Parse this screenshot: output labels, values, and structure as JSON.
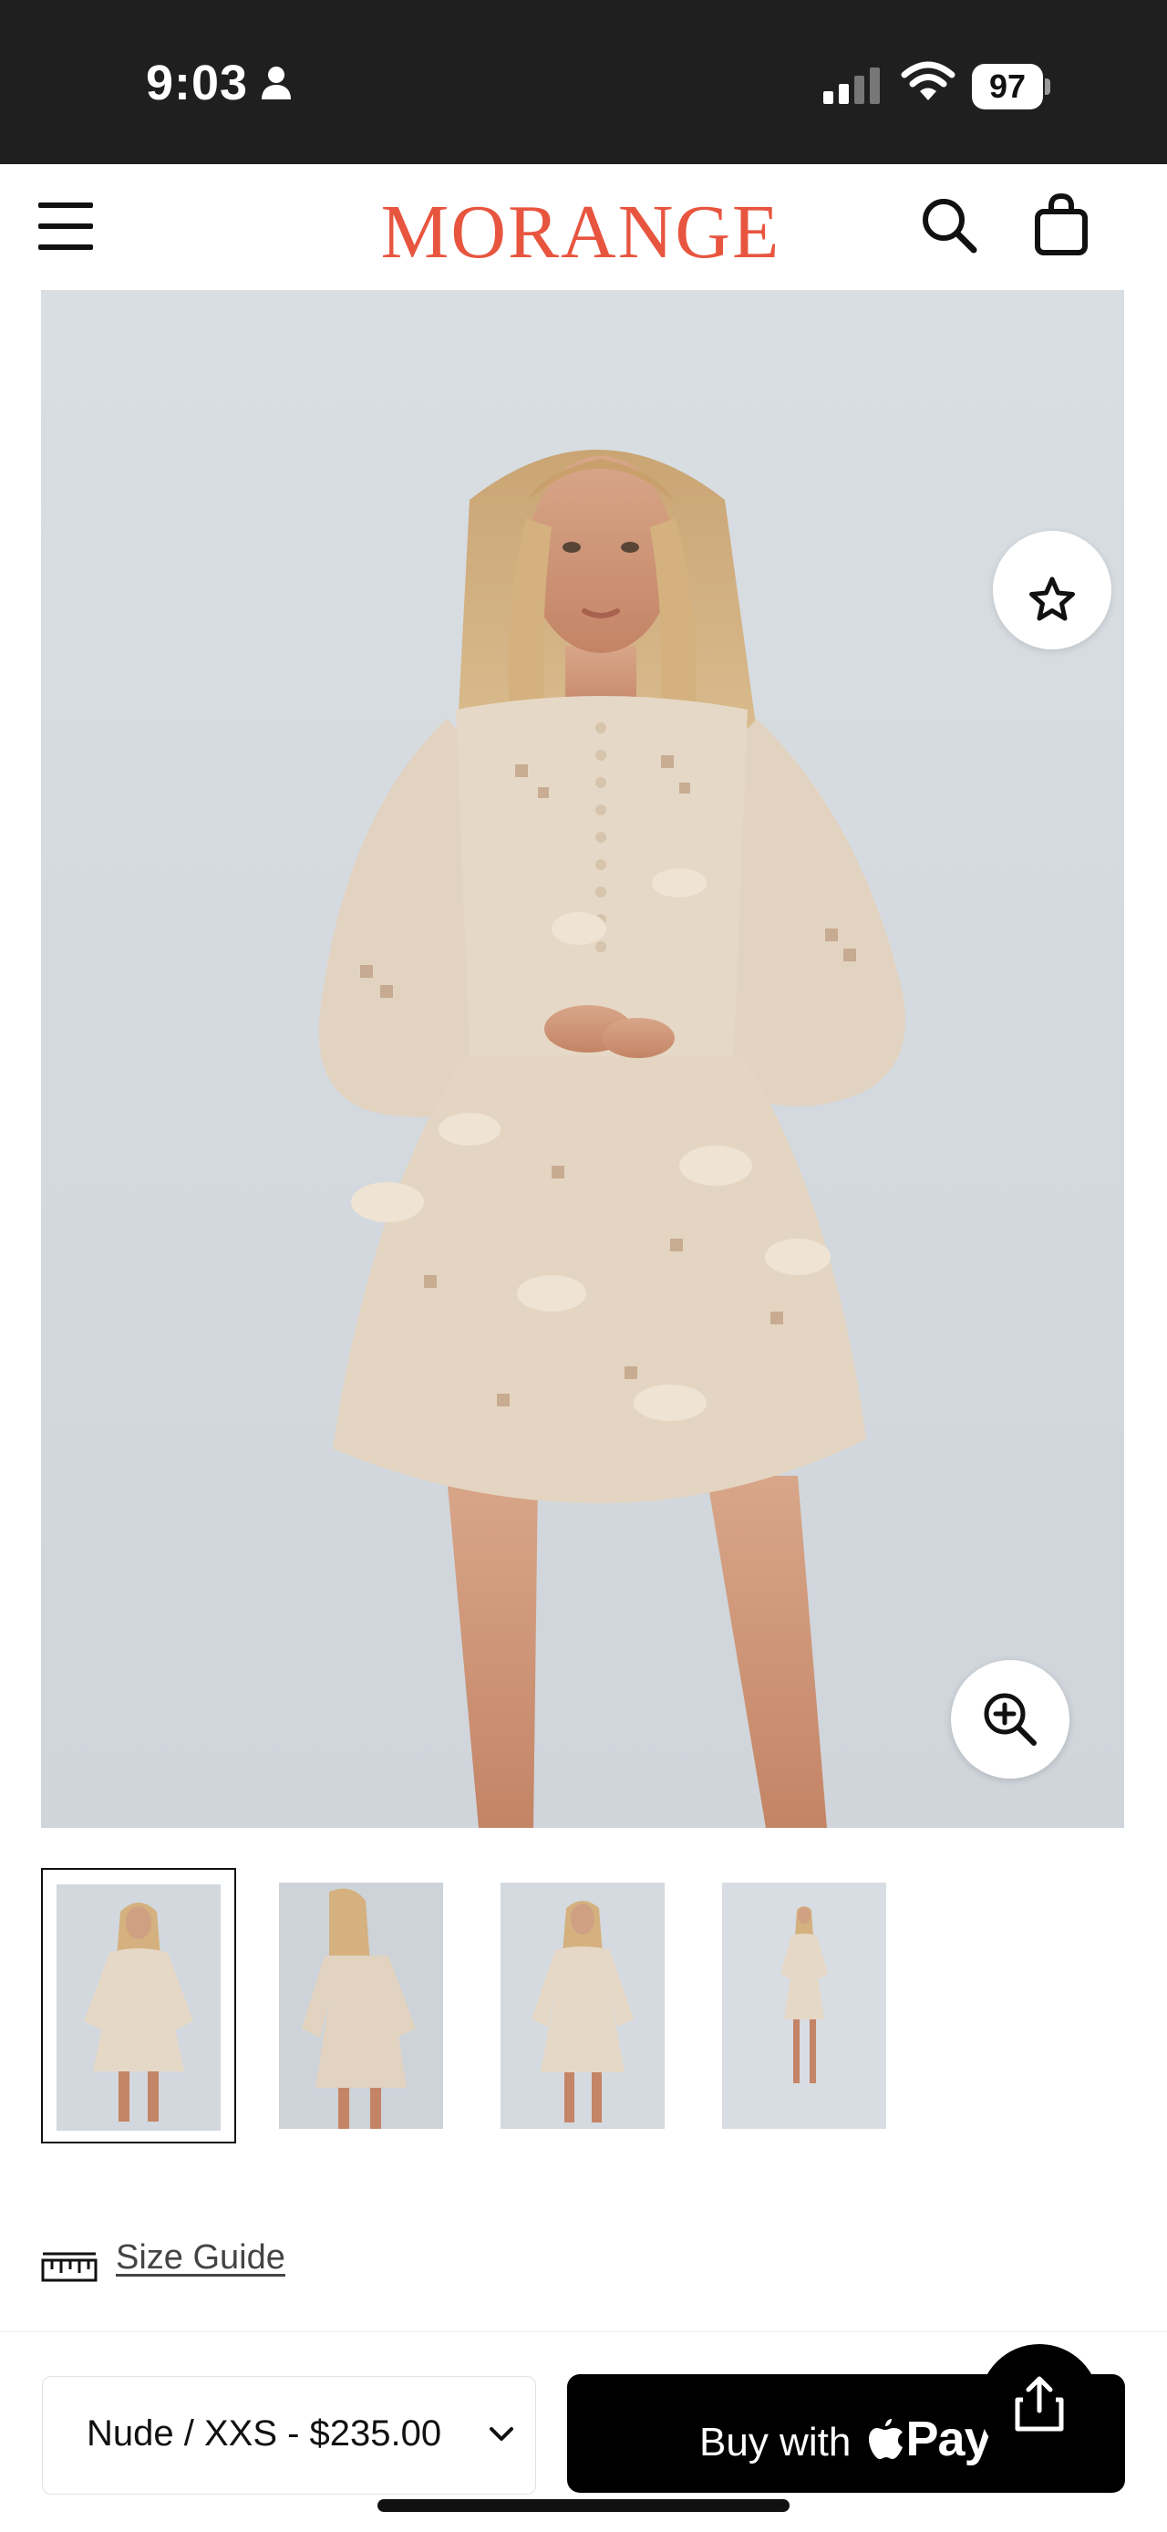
{
  "status_bar": {
    "time": "9:03",
    "battery_level": "97",
    "icons": [
      "person-icon",
      "signal-icon",
      "wifi-icon",
      "battery-icon"
    ]
  },
  "header": {
    "brand": "MORANGE",
    "brand_color": "#e8553f",
    "icons": [
      "menu-icon",
      "search-icon",
      "bag-icon"
    ]
  },
  "product_gallery": {
    "icons": [
      "star-icon",
      "zoom-in-icon"
    ],
    "thumbnail_count": 4,
    "selected_thumbnail": 1
  },
  "size_guide": {
    "label": "Size Guide",
    "icon": "ruler-icon"
  },
  "purchase_bar": {
    "variant": "Nude / XXS - $235.00",
    "buy_label": "Buy with",
    "pay_label": "Pay",
    "icons": [
      "chevron-down-icon",
      "apple-icon",
      "share-icon"
    ]
  }
}
